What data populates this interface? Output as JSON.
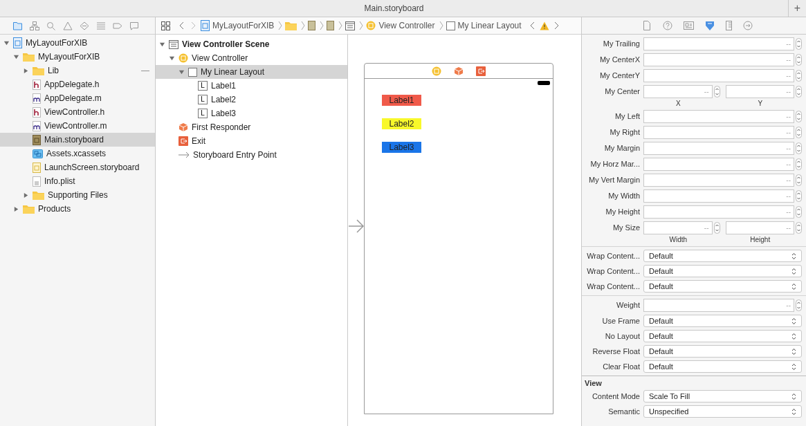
{
  "window": {
    "title": "Main.storyboard",
    "add_label": "+"
  },
  "navigator": {
    "tree": [
      {
        "label": "MyLayoutForXIB",
        "kind": "project",
        "expanded": true,
        "selected": false,
        "children": [
          {
            "label": "MyLayoutForXIB",
            "kind": "folder",
            "expanded": true,
            "selected": false,
            "children": [
              {
                "label": "Lib",
                "kind": "folder",
                "expanded": false,
                "selected": false,
                "badge": "—"
              },
              {
                "label": "AppDelegate.h",
                "kind": "header",
                "selected": false
              },
              {
                "label": "AppDelegate.m",
                "kind": "source",
                "selected": false
              },
              {
                "label": "ViewController.h",
                "kind": "header",
                "selected": false
              },
              {
                "label": "ViewController.m",
                "kind": "source",
                "selected": false
              },
              {
                "label": "Main.storyboard",
                "kind": "storyboard",
                "selected": true
              },
              {
                "label": "Assets.xcassets",
                "kind": "assets",
                "selected": false
              },
              {
                "label": "LaunchScreen.storyboard",
                "kind": "launch",
                "selected": false
              },
              {
                "label": "Info.plist",
                "kind": "plist",
                "selected": false
              },
              {
                "label": "Supporting Files",
                "kind": "folder",
                "expanded": false,
                "selected": false
              }
            ]
          },
          {
            "label": "Products",
            "kind": "folder",
            "expanded": false,
            "selected": false
          }
        ]
      }
    ]
  },
  "jump_bar": [
    {
      "kind": "project",
      "label": "MyLayoutForXIB"
    },
    {
      "kind": "folder"
    },
    {
      "kind": "storyboard"
    },
    {
      "kind": "storyboard"
    },
    {
      "kind": "scene"
    },
    {
      "kind": "controller",
      "label": "View Controller"
    },
    {
      "kind": "view",
      "label": "My Linear Layout"
    }
  ],
  "outline": [
    {
      "label": "View Controller Scene",
      "kind": "scene",
      "expanded": true,
      "selected": false,
      "children": [
        {
          "label": "View Controller",
          "kind": "controller",
          "expanded": true,
          "selected": false,
          "children": [
            {
              "label": "My Linear Layout",
              "kind": "view",
              "expanded": true,
              "selected": true,
              "children": [
                {
                  "label": "Label1",
                  "kind": "label",
                  "icon_text": "L",
                  "selected": false
                },
                {
                  "label": "Label2",
                  "kind": "label",
                  "icon_text": "L",
                  "selected": false
                },
                {
                  "label": "Label3",
                  "kind": "label",
                  "icon_text": "L",
                  "selected": false
                }
              ]
            }
          ]
        },
        {
          "label": "First Responder",
          "kind": "responder",
          "selected": false
        },
        {
          "label": "Exit",
          "kind": "exit",
          "selected": false
        },
        {
          "label": "Storyboard Entry Point",
          "kind": "entry",
          "selected": false
        }
      ]
    }
  ],
  "canvas": {
    "labels": [
      {
        "text": "Label1",
        "color": "#f05a4a"
      },
      {
        "text": "Label2",
        "color": "#f8f82a"
      },
      {
        "text": "Label3",
        "color": "#1a75e8"
      }
    ]
  },
  "inspector": {
    "groups": [
      {
        "rows": [
          {
            "kind": "stepper",
            "label": "My Trailing",
            "placeholder": "--"
          },
          {
            "kind": "stepper",
            "label": "My CenterX",
            "placeholder": "--"
          },
          {
            "kind": "stepper",
            "label": "My CenterY",
            "placeholder": "--"
          },
          {
            "kind": "pair",
            "label": "My Center",
            "placeholder": "--",
            "sub": [
              "X",
              "Y"
            ]
          },
          {
            "kind": "stepper",
            "label": "My Left",
            "placeholder": "--"
          },
          {
            "kind": "stepper",
            "label": "My Right",
            "placeholder": "--"
          },
          {
            "kind": "stepper",
            "label": "My Margin",
            "placeholder": "--"
          },
          {
            "kind": "stepper",
            "label": "My Horz Mar...",
            "placeholder": "--"
          },
          {
            "kind": "stepper",
            "label": "My Vert Margin",
            "placeholder": "--"
          },
          {
            "kind": "stepper",
            "label": "My Width",
            "placeholder": "--"
          },
          {
            "kind": "stepper",
            "label": "My Height",
            "placeholder": "--"
          },
          {
            "kind": "pair",
            "label": "My Size",
            "placeholder": "--",
            "sub": [
              "Width",
              "Height"
            ]
          }
        ]
      },
      {
        "rows": [
          {
            "kind": "select",
            "label": "Wrap Content...",
            "value": "Default"
          },
          {
            "kind": "select",
            "label": "Wrap Content...",
            "value": "Default"
          },
          {
            "kind": "select",
            "label": "Wrap Content...",
            "value": "Default"
          }
        ]
      },
      {
        "rows": [
          {
            "kind": "stepper",
            "label": "Weight",
            "placeholder": "--"
          },
          {
            "kind": "select",
            "label": "Use Frame",
            "value": "Default"
          },
          {
            "kind": "select",
            "label": "No Layout",
            "value": "Default"
          },
          {
            "kind": "select",
            "label": "Reverse Float",
            "value": "Default"
          },
          {
            "kind": "select",
            "label": "Clear Float",
            "value": "Default"
          }
        ]
      },
      {
        "title": "View",
        "rows": [
          {
            "kind": "select",
            "label": "Content Mode",
            "value": "Scale To Fill"
          },
          {
            "kind": "select",
            "label": "Semantic",
            "value": "Unspecified"
          }
        ]
      }
    ]
  }
}
